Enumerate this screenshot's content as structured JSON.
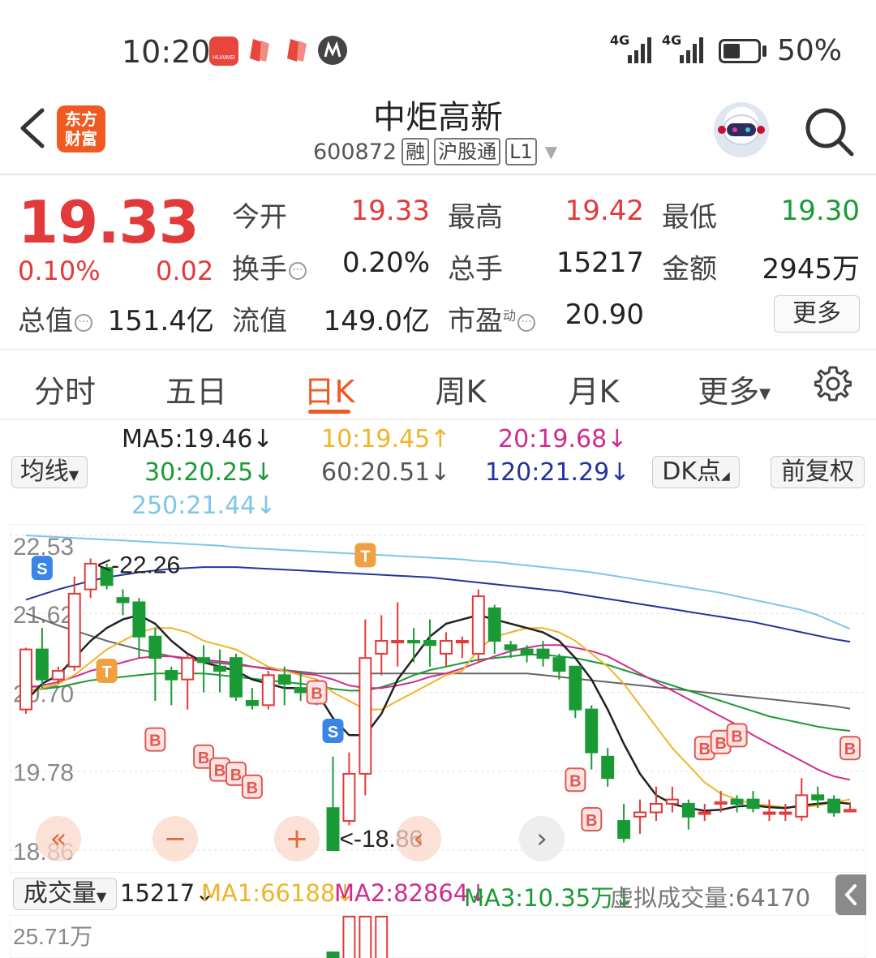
{
  "status_bar": {
    "time": "10:20",
    "app_badge": "HUAWEI",
    "signal1": "4G",
    "signal2": "4G",
    "battery_pct": "50%",
    "battery_level": 0.5
  },
  "header": {
    "logo_text_line1": "东方",
    "logo_text_line2": "财富",
    "stock_name": "中炬高新",
    "stock_code": "600872",
    "tags": [
      "融",
      "沪股通",
      "L1"
    ]
  },
  "quote": {
    "price": "19.33",
    "change_pct": "0.10%",
    "change_amt": "0.02",
    "open_label": "今开",
    "open": "19.33",
    "high_label": "最高",
    "high": "19.42",
    "low_label": "最低",
    "low": "19.30",
    "turnover_label": "换手",
    "turnover": "0.20%",
    "volume_label": "总手",
    "volume": "15217",
    "amount_label": "金额",
    "amount": "2945万",
    "mcap_label": "总值",
    "mcap": "151.4亿",
    "float_label": "流值",
    "float_cap": "149.0亿",
    "pe_label": "市盈",
    "pe_sup": "动",
    "pe": "20.90",
    "more": "更多"
  },
  "tabs": [
    "分时",
    "五日",
    "日K",
    "周K",
    "月K",
    "更多"
  ],
  "active_tab": "日K",
  "ma": {
    "selector": "均线",
    "ma5": "MA5:19.46↓",
    "ma10": "10:19.45↑",
    "ma20": "20:19.68↓",
    "ma30": "30:20.25↓",
    "ma60": "60:20.51↓",
    "ma120": "120:21.29↓",
    "ma250": "250:21.44↓",
    "dk": "DK点",
    "adjust": "前复权"
  },
  "colors": {
    "up": "#e23a3a",
    "down": "#1a9a35",
    "ma5": "#222222",
    "ma10": "#f0b429",
    "ma20": "#d02c8f",
    "ma30": "#1a9a35",
    "ma60": "#666666",
    "ma120": "#23349a",
    "ma250": "#7cc6e8"
  },
  "chart_data": {
    "type": "candlestick",
    "y_ticks": [
      "22.53",
      "21.62",
      "20.70",
      "19.78",
      "18.86"
    ],
    "ylim": [
      18.86,
      22.53
    ],
    "high_marker": "<-22.26",
    "low_marker": "<-18.86",
    "candles": [
      {
        "o": 20.5,
        "c": 21.2,
        "h": 21.22,
        "l": 20.45
      },
      {
        "o": 21.2,
        "c": 20.85,
        "h": 21.45,
        "l": 20.75
      },
      {
        "o": 20.85,
        "c": 20.95,
        "h": 21.0,
        "l": 20.8
      },
      {
        "o": 21.0,
        "c": 21.85,
        "h": 22.05,
        "l": 20.95
      },
      {
        "o": 21.9,
        "c": 22.2,
        "h": 22.26,
        "l": 21.8
      },
      {
        "o": 22.15,
        "c": 21.95,
        "h": 22.2,
        "l": 21.9
      },
      {
        "o": 21.8,
        "c": 21.75,
        "h": 21.9,
        "l": 21.6
      },
      {
        "o": 21.75,
        "c": 21.35,
        "h": 21.8,
        "l": 21.1
      },
      {
        "o": 21.35,
        "c": 21.1,
        "h": 21.45,
        "l": 20.6
      },
      {
        "o": 20.95,
        "c": 20.85,
        "h": 21.0,
        "l": 20.55
      },
      {
        "o": 20.85,
        "c": 21.1,
        "h": 21.15,
        "l": 20.5
      },
      {
        "o": 21.1,
        "c": 21.05,
        "h": 21.25,
        "l": 20.7
      },
      {
        "o": 21.0,
        "c": 20.95,
        "h": 21.2,
        "l": 20.7
      },
      {
        "o": 21.1,
        "c": 20.65,
        "h": 21.15,
        "l": 20.6
      },
      {
        "o": 20.6,
        "c": 20.55,
        "h": 20.75,
        "l": 20.5
      },
      {
        "o": 20.55,
        "c": 20.9,
        "h": 20.95,
        "l": 20.5
      },
      {
        "o": 20.9,
        "c": 20.8,
        "h": 21.0,
        "l": 20.55
      },
      {
        "o": 20.75,
        "c": 20.7,
        "h": 20.95,
        "l": 20.6
      },
      {
        "o": 20.7,
        "c": 20.65,
        "h": 20.85,
        "l": 20.55
      },
      {
        "o": 19.35,
        "c": 18.86,
        "h": 19.95,
        "l": 18.86
      },
      {
        "o": 19.2,
        "c": 19.75,
        "h": 20.0,
        "l": 19.15
      },
      {
        "o": 19.75,
        "c": 21.1,
        "h": 21.55,
        "l": 19.5
      },
      {
        "o": 21.15,
        "c": 21.3,
        "h": 21.6,
        "l": 20.9
      },
      {
        "o": 21.3,
        "c": 21.3,
        "h": 21.75,
        "l": 21.0
      },
      {
        "o": 21.3,
        "c": 21.28,
        "h": 21.45,
        "l": 21.05
      },
      {
        "o": 21.3,
        "c": 21.25,
        "h": 21.55,
        "l": 21.0
      },
      {
        "o": 21.15,
        "c": 21.3,
        "h": 21.4,
        "l": 21.0
      },
      {
        "o": 21.3,
        "c": 21.3,
        "h": 21.35,
        "l": 21.1
      },
      {
        "o": 21.15,
        "c": 21.82,
        "h": 21.9,
        "l": 21.05
      },
      {
        "o": 21.68,
        "c": 21.3,
        "h": 21.72,
        "l": 21.15
      },
      {
        "o": 21.25,
        "c": 21.2,
        "h": 21.3,
        "l": 21.1
      },
      {
        "o": 21.2,
        "c": 21.15,
        "h": 21.25,
        "l": 21.05
      },
      {
        "o": 21.2,
        "c": 21.1,
        "h": 21.3,
        "l": 21.0
      },
      {
        "o": 21.1,
        "c": 20.95,
        "h": 21.15,
        "l": 20.85
      },
      {
        "o": 21.0,
        "c": 20.5,
        "h": 21.0,
        "l": 20.4
      },
      {
        "o": 20.5,
        "c": 20.0,
        "h": 20.55,
        "l": 19.8
      },
      {
        "o": 19.95,
        "c": 19.7,
        "h": 20.05,
        "l": 19.6
      },
      {
        "o": 19.2,
        "c": 19.0,
        "h": 19.4,
        "l": 18.95
      },
      {
        "o": 19.25,
        "c": 19.3,
        "h": 19.45,
        "l": 19.05
      },
      {
        "o": 19.3,
        "c": 19.4,
        "h": 19.6,
        "l": 19.2
      },
      {
        "o": 19.4,
        "c": 19.45,
        "h": 19.6,
        "l": 19.3
      },
      {
        "o": 19.4,
        "c": 19.25,
        "h": 19.45,
        "l": 19.1
      },
      {
        "o": 19.3,
        "c": 19.3,
        "h": 19.4,
        "l": 19.2
      },
      {
        "o": 19.4,
        "c": 19.42,
        "h": 19.55,
        "l": 19.3
      },
      {
        "o": 19.45,
        "c": 19.4,
        "h": 19.5,
        "l": 19.3
      },
      {
        "o": 19.45,
        "c": 19.35,
        "h": 19.55,
        "l": 19.3
      },
      {
        "o": 19.3,
        "c": 19.3,
        "h": 19.45,
        "l": 19.2
      },
      {
        "o": 19.3,
        "c": 19.3,
        "h": 19.4,
        "l": 19.2
      },
      {
        "o": 19.25,
        "c": 19.5,
        "h": 19.7,
        "l": 19.2
      },
      {
        "o": 19.5,
        "c": 19.45,
        "h": 19.6,
        "l": 19.35
      },
      {
        "o": 19.45,
        "c": 19.3,
        "h": 19.5,
        "l": 19.25
      },
      {
        "o": 19.31,
        "c": 19.33,
        "h": 19.42,
        "l": 19.3
      }
    ],
    "ma_lines": {
      "ma5": [
        20.6,
        20.8,
        20.9,
        21.1,
        21.3,
        21.45,
        21.55,
        21.6,
        21.5,
        21.3,
        21.15,
        21.05,
        21.0,
        20.95,
        20.85,
        20.8,
        20.75,
        20.75,
        20.7,
        20.4,
        20.2,
        20.2,
        20.45,
        20.85,
        21.1,
        21.35,
        21.5,
        21.55,
        21.6,
        21.55,
        21.5,
        21.45,
        21.4,
        21.3,
        21.1,
        20.85,
        20.5,
        20.1,
        19.75,
        19.5,
        19.4,
        19.35,
        19.32,
        19.33,
        19.37,
        19.38,
        19.36,
        19.35,
        19.38,
        19.4,
        19.42,
        19.4
      ],
      "ma10": [
        20.7,
        20.75,
        20.8,
        20.9,
        21.05,
        21.2,
        21.3,
        21.4,
        21.45,
        21.45,
        21.4,
        21.3,
        21.25,
        21.2,
        21.1,
        21.0,
        20.95,
        20.9,
        20.85,
        20.7,
        20.6,
        20.5,
        20.5,
        20.6,
        20.7,
        20.8,
        20.9,
        20.95,
        21.2,
        21.35,
        21.4,
        21.45,
        21.45,
        21.4,
        21.3,
        21.15,
        21.0,
        20.8,
        20.55,
        20.3,
        20.05,
        19.85,
        19.65,
        19.52,
        19.45,
        19.4,
        19.38,
        19.36,
        19.36,
        19.38,
        19.42,
        19.45
      ],
      "ma20": [
        20.75,
        20.78,
        20.82,
        20.88,
        20.95,
        21.0,
        21.05,
        21.1,
        21.12,
        21.12,
        21.1,
        21.08,
        21.06,
        21.04,
        21.0,
        20.97,
        20.95,
        20.92,
        20.9,
        20.85,
        20.78,
        20.75,
        20.75,
        20.78,
        20.82,
        20.88,
        20.92,
        20.98,
        21.05,
        21.12,
        21.18,
        21.22,
        21.25,
        21.25,
        21.22,
        21.18,
        21.12,
        21.02,
        20.92,
        20.82,
        20.72,
        20.62,
        20.52,
        20.42,
        20.32,
        20.2,
        20.1,
        20.0,
        19.9,
        19.8,
        19.72,
        19.68
      ],
      "ma30": [
        20.72,
        20.74,
        20.76,
        20.8,
        20.84,
        20.86,
        20.88,
        20.9,
        20.92,
        20.92,
        20.92,
        20.92,
        20.9,
        20.88,
        20.86,
        20.84,
        20.82,
        20.8,
        20.78,
        20.74,
        20.72,
        20.72,
        20.76,
        20.82,
        20.9,
        20.96,
        21.0,
        21.04,
        21.08,
        21.1,
        21.12,
        21.14,
        21.14,
        21.12,
        21.1,
        21.06,
        21.02,
        20.96,
        20.9,
        20.84,
        20.78,
        20.72,
        20.66,
        20.6,
        20.54,
        20.48,
        20.42,
        20.38,
        20.34,
        20.3,
        20.27,
        20.25
      ],
      "ma60": [
        21.62,
        21.55,
        21.48,
        21.42,
        21.36,
        21.3,
        21.25,
        21.2,
        21.16,
        21.12,
        21.08,
        21.06,
        21.04,
        21.02,
        21.0,
        20.98,
        20.96,
        20.94,
        20.92,
        20.92,
        20.92,
        20.92,
        20.92,
        20.92,
        20.92,
        20.92,
        20.92,
        20.92,
        20.92,
        20.92,
        20.92,
        20.92,
        20.9,
        20.88,
        20.86,
        20.84,
        20.82,
        20.8,
        20.78,
        20.76,
        20.74,
        20.72,
        20.7,
        20.68,
        20.66,
        20.64,
        20.62,
        20.6,
        20.58,
        20.56,
        20.54,
        20.51
      ],
      "ma120": [
        21.78,
        21.84,
        21.9,
        21.95,
        22.0,
        22.04,
        22.07,
        22.1,
        22.12,
        22.14,
        22.15,
        22.16,
        22.16,
        22.16,
        22.15,
        22.14,
        22.13,
        22.12,
        22.11,
        22.1,
        22.09,
        22.08,
        22.07,
        22.06,
        22.05,
        22.04,
        22.02,
        22.0,
        21.98,
        21.96,
        21.94,
        21.92,
        21.9,
        21.88,
        21.85,
        21.82,
        21.79,
        21.76,
        21.73,
        21.7,
        21.67,
        21.64,
        21.61,
        21.58,
        21.55,
        21.52,
        21.48,
        21.44,
        21.4,
        21.36,
        21.32,
        21.29
      ],
      "ma250": [
        22.53,
        22.52,
        22.51,
        22.5,
        22.49,
        22.48,
        22.47,
        22.46,
        22.45,
        22.44,
        22.43,
        22.42,
        22.41,
        22.39,
        22.38,
        22.37,
        22.36,
        22.35,
        22.34,
        22.33,
        22.32,
        22.31,
        22.3,
        22.29,
        22.28,
        22.27,
        22.26,
        22.25,
        22.23,
        22.22,
        22.2,
        22.18,
        22.16,
        22.14,
        22.12,
        22.1,
        22.07,
        22.04,
        22.01,
        21.98,
        21.95,
        21.92,
        21.89,
        21.86,
        21.82,
        21.78,
        21.74,
        21.7,
        21.66,
        21.6,
        21.52,
        21.44
      ]
    },
    "signals": [
      {
        "i": 1,
        "label": "S",
        "kind": "sell",
        "price": 22.15
      },
      {
        "i": 5,
        "label": "T",
        "kind": "t",
        "price": 20.95
      },
      {
        "i": 8,
        "label": "B",
        "kind": "buy",
        "price": 20.15
      },
      {
        "i": 11,
        "label": "B",
        "kind": "buy",
        "price": 19.95
      },
      {
        "i": 12,
        "label": "B",
        "kind": "buy",
        "price": 19.8
      },
      {
        "i": 13,
        "label": "B",
        "kind": "buy",
        "price": 19.75
      },
      {
        "i": 14,
        "label": "B",
        "kind": "buy",
        "price": 19.6
      },
      {
        "i": 18,
        "label": "B",
        "kind": "buy",
        "price": 20.7
      },
      {
        "i": 19,
        "label": "S",
        "kind": "sell",
        "price": 20.25
      },
      {
        "i": 21,
        "label": "T",
        "kind": "t",
        "price": 22.3
      },
      {
        "i": 34,
        "label": "B",
        "kind": "buy",
        "price": 19.68
      },
      {
        "i": 35,
        "label": "B",
        "kind": "buy",
        "price": 19.22
      },
      {
        "i": 42,
        "label": "B",
        "kind": "buy",
        "price": 20.05
      },
      {
        "i": 43,
        "label": "B",
        "kind": "buy",
        "price": 20.12
      },
      {
        "i": 44,
        "label": "B",
        "kind": "buy",
        "price": 20.2
      },
      {
        "i": 51,
        "label": "B",
        "kind": "buy",
        "price": 20.05
      }
    ]
  },
  "nav_buttons": [
    "«",
    "−",
    "+",
    "‹",
    "›"
  ],
  "volume": {
    "selector": "成交量",
    "current": "15217↓",
    "ma1": "MA1:66188↓",
    "ma2": "MA2:82864↓",
    "ma3": "MA3:10.35万↓",
    "virtual": "虚拟成交量:64170",
    "top_tick": "25.71万"
  }
}
